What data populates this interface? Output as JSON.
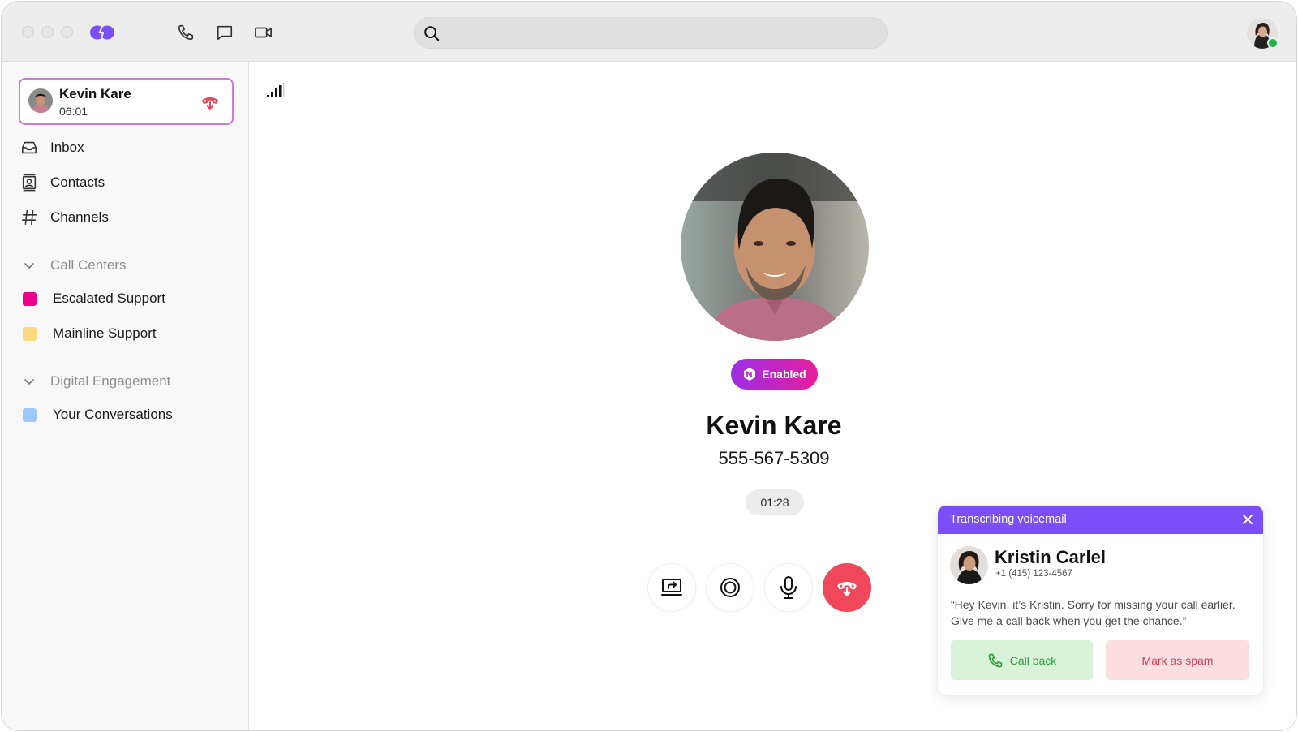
{
  "titlebar": {
    "window_controls": [
      "close",
      "minimize",
      "zoom"
    ],
    "app_logo": "dialpad-logo",
    "nav_icons": [
      {
        "name": "phone-icon",
        "label": "Calls"
      },
      {
        "name": "chat-icon",
        "label": "Messages"
      },
      {
        "name": "video-icon",
        "label": "Video"
      }
    ],
    "search": {
      "placeholder": "",
      "value": ""
    },
    "user_status": "online"
  },
  "sidebar": {
    "active_call": {
      "name": "Kevin Kare",
      "duration": "06:01"
    },
    "nav_items": [
      {
        "label": "Inbox",
        "icon": "inbox-icon"
      },
      {
        "label": "Contacts",
        "icon": "contacts-icon"
      },
      {
        "label": "Channels",
        "icon": "hash-icon"
      }
    ],
    "sections": [
      {
        "label": "Call Centers",
        "expanded": true,
        "items": [
          {
            "label": "Escalated Support",
            "color": "#ec008c"
          },
          {
            "label": "Mainline Support",
            "color": "#fcd97c"
          }
        ]
      },
      {
        "label": "Digital Engagement",
        "expanded": true,
        "items": [
          {
            "label": "Your Conversations",
            "color": "#9dc8fb"
          }
        ]
      }
    ]
  },
  "call": {
    "contact_name": "Kevin Kare",
    "phone": "555-567-5309",
    "badge": "Enabled",
    "timer": "01:28",
    "controls": [
      {
        "name": "screen-share",
        "label": "Share screen"
      },
      {
        "name": "record",
        "label": "Record"
      },
      {
        "name": "mute",
        "label": "Microphone"
      },
      {
        "name": "hang-up",
        "label": "End call"
      }
    ]
  },
  "voicemail": {
    "title": "Transcribing voicemail",
    "caller_name": "Kristin Carlel",
    "caller_phone": "+1 (415) 123-4567",
    "transcript": "“Hey Kevin, it’s Kristin. Sorry for missing your call earlier. Give me a call back when you get the chance.”",
    "call_back_label": "Call back",
    "spam_label": "Mark as spam"
  },
  "colors": {
    "accent": "#7b4ef9",
    "end_call": "#f1475a",
    "online": "#22b14c",
    "badge_start": "#9c2ee6",
    "badge_end": "#e61d9d"
  }
}
